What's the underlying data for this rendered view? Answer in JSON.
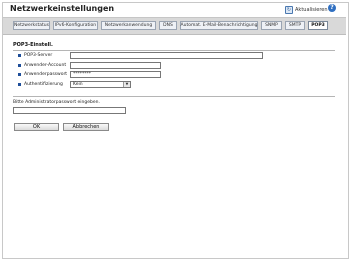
{
  "header": {
    "title": "Netzwerkeinstellungen",
    "refresh_label": "Aktualisieren",
    "help_symbol": "?"
  },
  "tabs": [
    {
      "label": "Netzwerkstatus",
      "active": false
    },
    {
      "label": "IPv6-Konfiguration",
      "active": false
    },
    {
      "label": "Netzwerkanwendung",
      "active": false
    },
    {
      "label": "DNS",
      "active": false
    },
    {
      "label": "Automat. E-Mail-Benachrichtigung",
      "active": false
    },
    {
      "label": "SNMP",
      "active": false
    },
    {
      "label": "SMTP",
      "active": false
    },
    {
      "label": "POP3",
      "active": true
    }
  ],
  "section": {
    "title": "POP3-Einstell.",
    "fields": {
      "server_label": "POP3-Server",
      "server_value": "",
      "account_label": "Anwender-Account",
      "account_value": "",
      "password_label": "Anwenderpasswort",
      "password_value": "********",
      "auth_label": "Authentifizierung",
      "auth_value": "Kein"
    }
  },
  "admin": {
    "label": "Bitte Administratorpasswort eingeben.",
    "value": ""
  },
  "buttons": {
    "ok": "OK",
    "cancel": "Abbrechen"
  },
  "colors": {
    "accent": "#1f4f9a",
    "tab_bar": "#d9d9d9"
  }
}
